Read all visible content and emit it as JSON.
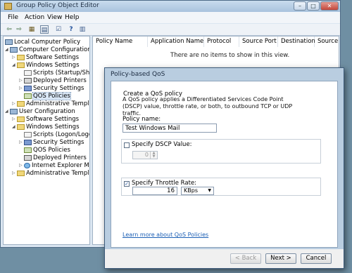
{
  "window": {
    "title": "Group Policy Object Editor",
    "controls": {
      "minimize": "–",
      "maximize": "□",
      "close": "✕"
    }
  },
  "menubar": [
    "File",
    "Action",
    "View",
    "Help"
  ],
  "toolbar": {
    "icons": [
      "back-arrow-icon",
      "forward-arrow-icon",
      "up-folder-icon",
      "show-hide-tree-icon",
      "properties-icon",
      "help-icon",
      "console-icon"
    ],
    "glyphs": [
      "⇦",
      "⇨",
      "▦",
      "▤",
      "☑",
      "?",
      "▥"
    ]
  },
  "tree": {
    "items": [
      {
        "label": "Local Computer Policy",
        "icon": "computer-policy-icon"
      },
      {
        "label": "Computer Configuration",
        "icon": "computer-icon",
        "expander": "◢"
      },
      {
        "label": "Software Settings",
        "icon": "folder-icon",
        "expander": "▷"
      },
      {
        "label": "Windows Settings",
        "icon": "folder-icon",
        "expander": "◢"
      },
      {
        "label": "Scripts (Startup/Shut",
        "icon": "scripts-icon"
      },
      {
        "label": "Deployed Printers",
        "icon": "printer-icon",
        "expander": "▷"
      },
      {
        "label": "Security Settings",
        "icon": "security-icon",
        "expander": "▷"
      },
      {
        "label": "QOS Policies",
        "icon": "qos-policy-icon",
        "selected": true
      },
      {
        "label": "Administrative Template",
        "icon": "folder-icon",
        "expander": "▷"
      },
      {
        "label": "User Configuration",
        "icon": "user-icon",
        "expander": "◢"
      },
      {
        "label": "Software Settings",
        "icon": "folder-icon",
        "expander": "▷"
      },
      {
        "label": "Windows Settings",
        "icon": "folder-icon",
        "expander": "◢"
      },
      {
        "label": "Scripts (Logon/Logo",
        "icon": "scripts-icon"
      },
      {
        "label": "Security Settings",
        "icon": "security-icon",
        "expander": "▷"
      },
      {
        "label": "QOS Policies",
        "icon": "qos-policy-icon"
      },
      {
        "label": "Deployed Printers",
        "icon": "printer-icon"
      },
      {
        "label": "Internet Explorer Mai",
        "icon": "ie-icon",
        "expander": "▷"
      },
      {
        "label": "Administrative Template",
        "icon": "folder-icon",
        "expander": "▷"
      }
    ]
  },
  "grid": {
    "columns": [
      "Policy Name",
      "Application Name",
      "Protocol",
      "Source Port",
      "Destination ...",
      "Source IP / ..."
    ],
    "empty_message": "There are no items to show in this view."
  },
  "dialog": {
    "title": "Policy-based QoS",
    "heading": "Create a QoS policy",
    "description": "A QoS policy applies a Differentiated Services Code Point (DSCP) value, throttle rate, or both, to outbound TCP or UDP traffic.",
    "policy_name_label": "Policy name:",
    "policy_name_value": "Test Windows Mail",
    "dscp_label": "Specify DSCP Value:",
    "dscp_checked": false,
    "dscp_value": "0",
    "throttle_label": "Specify Throttle Rate:",
    "throttle_checked": true,
    "throttle_value": "16",
    "throttle_unit": "KBps",
    "learn_more": "Learn more about QoS Policies",
    "buttons": {
      "back": "< Back",
      "next": "Next >",
      "cancel": "Cancel"
    }
  },
  "colors": {
    "selection": "#d9e7f7",
    "link": "#1b5fb5",
    "dialog_frame": "#b9cde0"
  }
}
